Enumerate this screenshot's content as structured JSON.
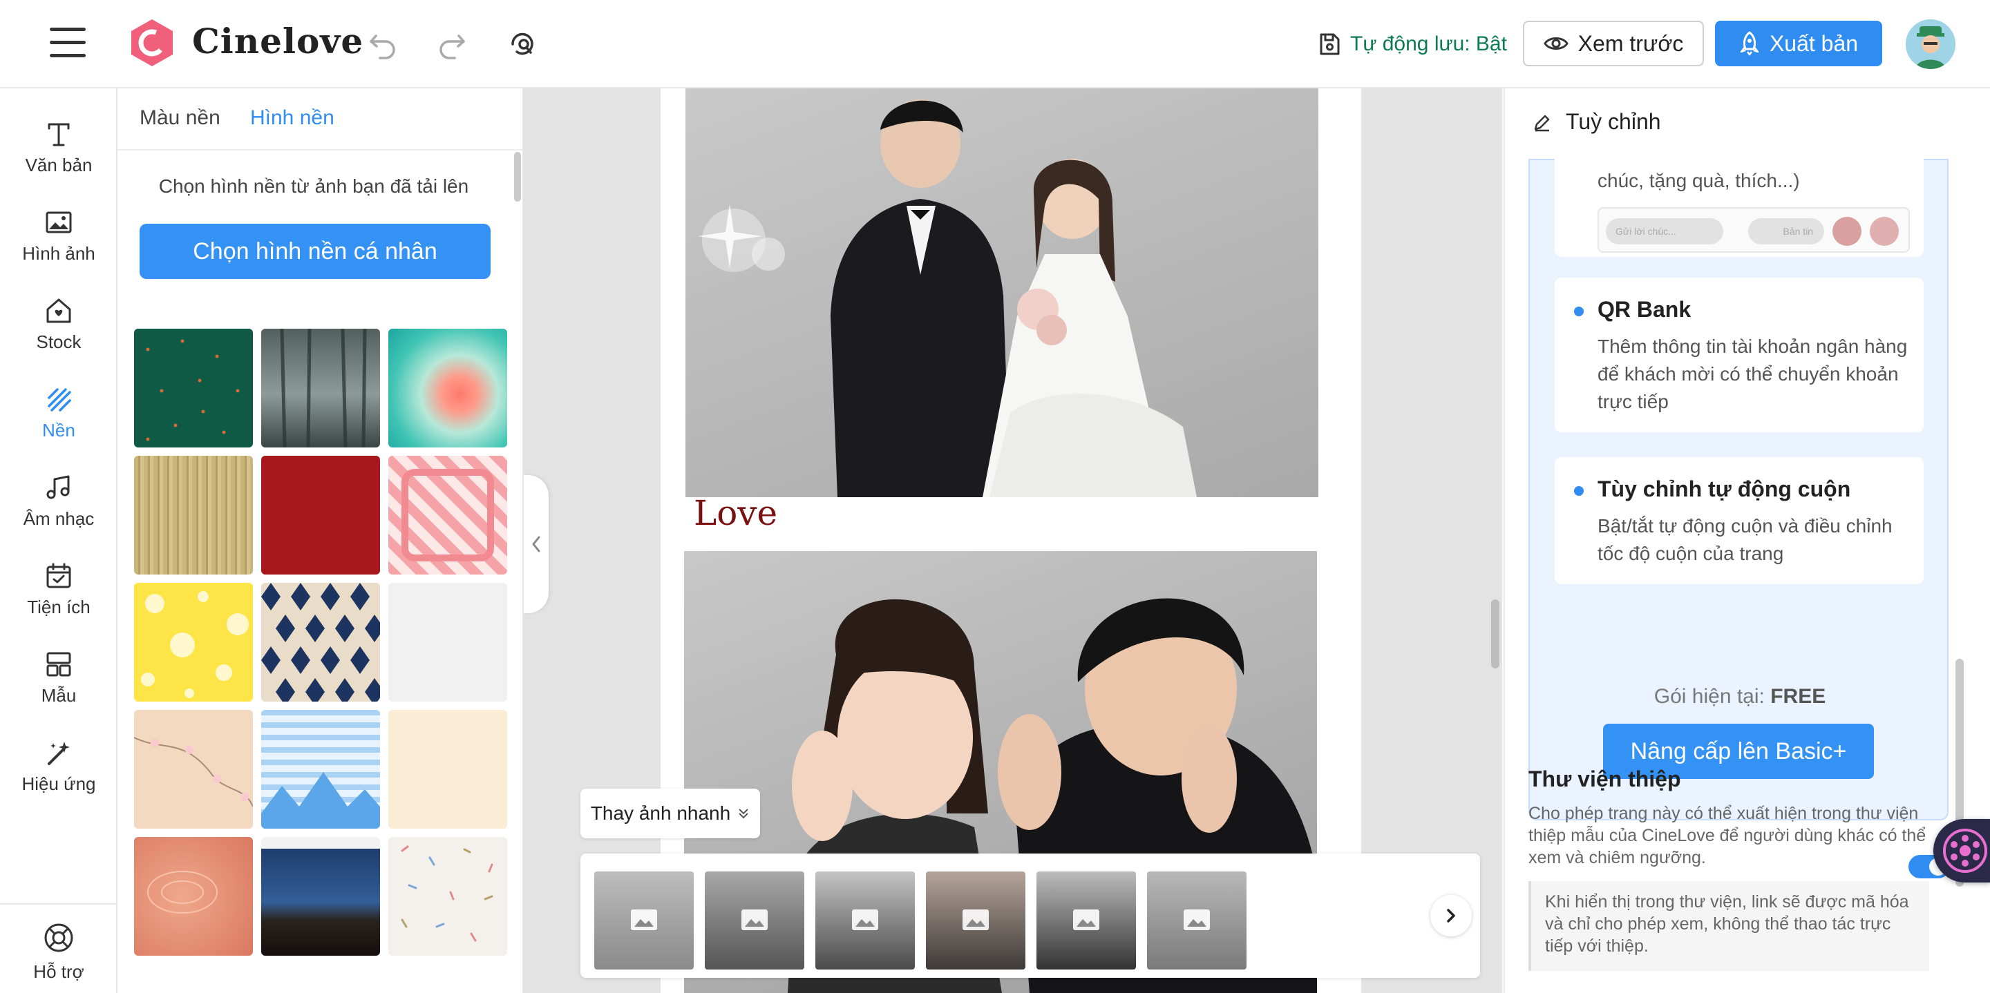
{
  "header": {
    "brand": "Cinelove",
    "autosave_label": "Tự động lưu: Bật",
    "preview_label": "Xem trước",
    "publish_label": "Xuất bản"
  },
  "rail": {
    "items": [
      {
        "label": "Văn bản",
        "icon": "text-icon"
      },
      {
        "label": "Hình ảnh",
        "icon": "image-icon"
      },
      {
        "label": "Stock",
        "icon": "stock-icon"
      },
      {
        "label": "Nền",
        "icon": "background-icon",
        "active": true
      },
      {
        "label": "Âm nhạc",
        "icon": "music-icon"
      },
      {
        "label": "Tiện ích",
        "icon": "calendar-icon"
      },
      {
        "label": "Mẫu",
        "icon": "template-icon"
      },
      {
        "label": "Hiệu ứng",
        "icon": "magic-wand-icon"
      }
    ],
    "help_label": "Hỗ trợ"
  },
  "background_panel": {
    "tabs": [
      "Màu nền",
      "Hình nền"
    ],
    "active_tab": "Hình nền",
    "hint": "Chọn hình nền từ ảnh bạn đã tải lên",
    "upload_label": "Chọn hình nền cá nhân"
  },
  "canvas": {
    "love_text": "Love",
    "quick_swap_label": "Thay ảnh nhanh"
  },
  "right_panel": {
    "title": "Tuỳ chỉnh",
    "partial_text": "chúc, tặng quà, thích...)",
    "mini_input_placeholder": "Gửi lời chúc...",
    "mini_button_label": "Bản tin",
    "features": [
      {
        "title": "QR Bank",
        "desc": "Thêm thông tin tài khoản ngân hàng để khách mời có thể chuyển khoản trực tiếp"
      },
      {
        "title": "Tùy chỉnh tự động cuộn",
        "desc": "Bật/tắt tự động cuộn và điều chỉnh tốc độ cuộn của trang"
      }
    ],
    "plan_prefix": "Gói hiện tại: ",
    "plan_name": "FREE",
    "upgrade_label": "Nâng cấp lên Basic+",
    "library": {
      "title": "Thư viện thiệp",
      "desc": "Cho phép trang này có thể xuất hiện trong thư viện thiệp mẫu của CineLove để người dùng khác có thể xem và chiêm ngưỡng.",
      "note": "Khi hiển thị trong thư viện, link sẽ được mã hóa và chỉ cho phép xem, không thể thao tác trực tiếp với thiệp.",
      "enabled": true
    }
  },
  "colors": {
    "accent": "#2f8df2",
    "autosave": "#0b7a55",
    "love_text": "#7a1010",
    "feature_bg": "#eaf3ff"
  }
}
